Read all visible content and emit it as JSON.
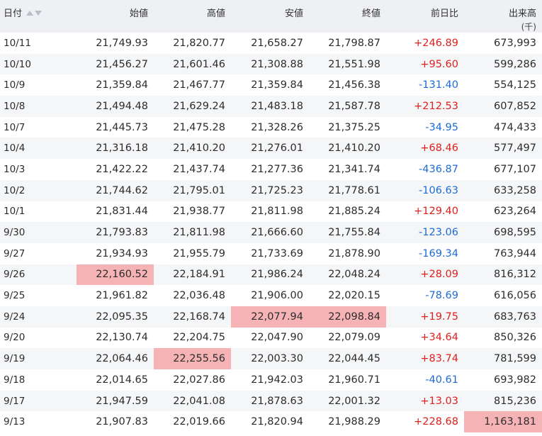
{
  "headers": [
    "日付",
    "始値",
    "高値",
    "安値",
    "終値",
    "前日比",
    "出来高"
  ],
  "volume_unit": "(千)",
  "colors": {
    "positive": "#e0201c",
    "negative": "#1f6bd6",
    "highlight": "#f6b3b5",
    "header_bg": "#eef0f3"
  },
  "rows": [
    {
      "date": "10/11",
      "open": "21,749.93",
      "high": "21,820.77",
      "low": "21,658.27",
      "close": "21,798.87",
      "change": "+246.89",
      "volume": "673,993"
    },
    {
      "date": "10/10",
      "open": "21,456.27",
      "high": "21,601.46",
      "low": "21,308.88",
      "close": "21,551.98",
      "change": "+95.60",
      "volume": "599,286"
    },
    {
      "date": "10/9",
      "open": "21,359.84",
      "high": "21,467.77",
      "low": "21,359.84",
      "close": "21,456.38",
      "change": "-131.40",
      "volume": "554,125"
    },
    {
      "date": "10/8",
      "open": "21,494.48",
      "high": "21,629.24",
      "low": "21,483.18",
      "close": "21,587.78",
      "change": "+212.53",
      "volume": "607,852"
    },
    {
      "date": "10/7",
      "open": "21,445.73",
      "high": "21,475.28",
      "low": "21,328.26",
      "close": "21,375.25",
      "change": "-34.95",
      "volume": "474,433"
    },
    {
      "date": "10/4",
      "open": "21,316.18",
      "high": "21,410.20",
      "low": "21,276.01",
      "close": "21,410.20",
      "change": "+68.46",
      "volume": "577,497"
    },
    {
      "date": "10/3",
      "open": "21,422.22",
      "high": "21,437.74",
      "low": "21,277.36",
      "close": "21,341.74",
      "change": "-436.87",
      "volume": "677,107"
    },
    {
      "date": "10/2",
      "open": "21,744.62",
      "high": "21,795.01",
      "low": "21,725.23",
      "close": "21,778.61",
      "change": "-106.63",
      "volume": "633,258"
    },
    {
      "date": "10/1",
      "open": "21,831.44",
      "high": "21,938.77",
      "low": "21,811.98",
      "close": "21,885.24",
      "change": "+129.40",
      "volume": "623,264"
    },
    {
      "date": "9/30",
      "open": "21,793.83",
      "high": "21,811.98",
      "low": "21,666.60",
      "close": "21,755.84",
      "change": "-123.06",
      "volume": "698,595"
    },
    {
      "date": "9/27",
      "open": "21,934.93",
      "high": "21,955.79",
      "low": "21,733.69",
      "close": "21,878.90",
      "change": "-169.34",
      "volume": "763,944"
    },
    {
      "date": "9/26",
      "open": "22,160.52",
      "high": "22,184.91",
      "low": "21,986.24",
      "close": "22,048.24",
      "change": "+28.09",
      "volume": "816,312",
      "highlight": [
        "open"
      ]
    },
    {
      "date": "9/25",
      "open": "21,961.82",
      "high": "22,036.48",
      "low": "21,906.00",
      "close": "22,020.15",
      "change": "-78.69",
      "volume": "616,056"
    },
    {
      "date": "9/24",
      "open": "22,095.35",
      "high": "22,168.74",
      "low": "22,077.94",
      "close": "22,098.84",
      "change": "+19.75",
      "volume": "683,763",
      "highlight": [
        "low",
        "close"
      ]
    },
    {
      "date": "9/20",
      "open": "22,130.74",
      "high": "22,204.75",
      "low": "22,047.90",
      "close": "22,079.09",
      "change": "+34.64",
      "volume": "850,326"
    },
    {
      "date": "9/19",
      "open": "22,064.46",
      "high": "22,255.56",
      "low": "22,003.30",
      "close": "22,044.45",
      "change": "+83.74",
      "volume": "781,599",
      "highlight": [
        "high"
      ]
    },
    {
      "date": "9/18",
      "open": "22,014.65",
      "high": "22,027.86",
      "low": "21,942.03",
      "close": "21,960.71",
      "change": "-40.61",
      "volume": "693,982"
    },
    {
      "date": "9/17",
      "open": "21,947.59",
      "high": "22,041.08",
      "low": "21,878.63",
      "close": "22,001.32",
      "change": "+13.03",
      "volume": "815,236"
    },
    {
      "date": "9/13",
      "open": "21,907.83",
      "high": "22,019.66",
      "low": "21,820.94",
      "close": "21,988.29",
      "change": "+228.68",
      "volume": "1,163,181",
      "highlight": [
        "volume"
      ]
    }
  ]
}
